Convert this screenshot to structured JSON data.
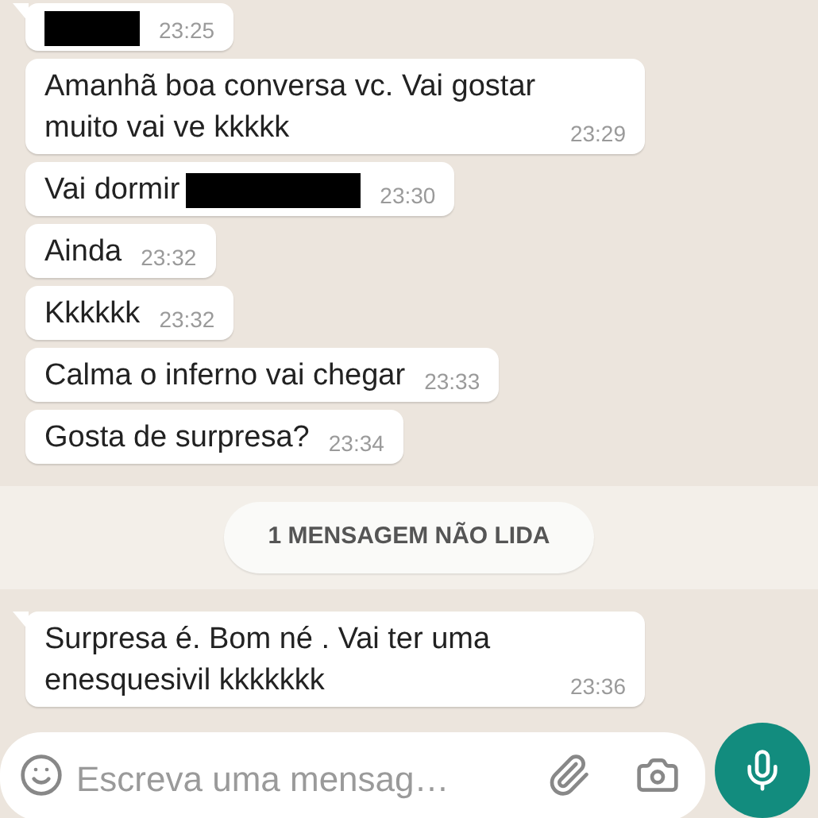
{
  "messages": [
    {
      "time": "23:25",
      "redacted": true,
      "tail": true
    },
    {
      "text": "Amanhã boa conversa vc. Vai gostar muito vai ve kkkkk",
      "time": "23:29",
      "redacted": false,
      "tail": false
    },
    {
      "text": "Vai dormir",
      "time": "23:30",
      "redacted": true,
      "tail": false
    },
    {
      "text": "Ainda",
      "time": "23:32",
      "redacted": false,
      "tail": false
    },
    {
      "text": "Kkkkkk",
      "time": "23:32",
      "redacted": false,
      "tail": false
    },
    {
      "text": "Calma o inferno vai chegar",
      "time": "23:33",
      "redacted": false,
      "tail": false
    },
    {
      "text": "Gosta de surpresa?",
      "time": "23:34",
      "redacted": false,
      "tail": false
    }
  ],
  "unread_banner": "1 MENSAGEM NÃO LIDA",
  "new_messages": [
    {
      "text": "Surpresa é. Bom né . Vai ter uma enesquesivil kkkkkkk",
      "time": "23:36",
      "redacted": false,
      "tail": true
    }
  ],
  "composer": {
    "placeholder": "Escreva uma mensag…"
  }
}
